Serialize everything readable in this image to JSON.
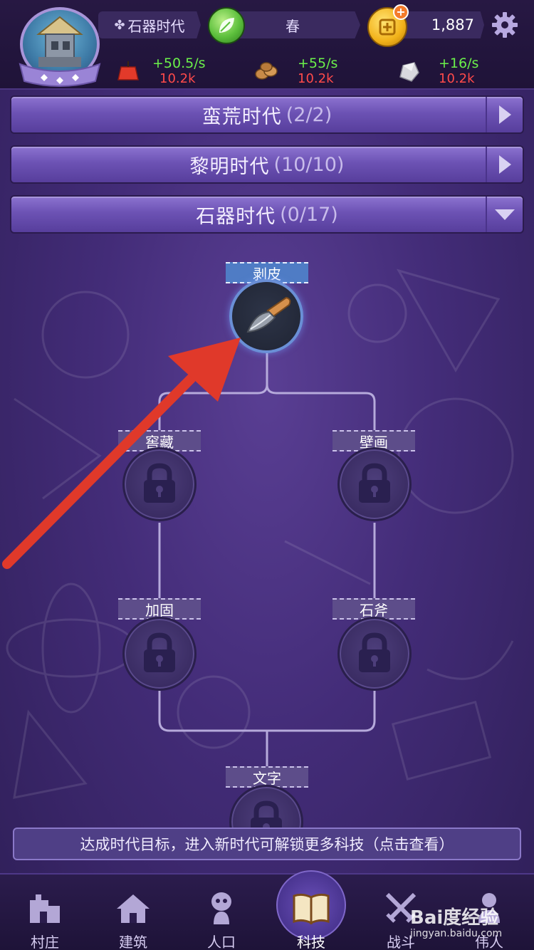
{
  "header": {
    "era_pill": "石器时代",
    "season_pill": "春",
    "gold_amount": "1,887",
    "resources": [
      {
        "icon": "apple-icon",
        "rate": "+50.5/s",
        "amount": "10.2k"
      },
      {
        "icon": "wood-logs-icon",
        "rate": "+55/s",
        "amount": "10.2k"
      },
      {
        "icon": "stone-icon",
        "rate": "+16/s",
        "amount": "10.2k"
      }
    ]
  },
  "eras": [
    {
      "name": "蛮荒时代",
      "count": "(2/2)",
      "state": "collapsed"
    },
    {
      "name": "黎明时代",
      "count": "(10/10)",
      "state": "collapsed"
    },
    {
      "name": "石器时代",
      "count": "(0/17)",
      "state": "expanded"
    }
  ],
  "tech_tree": {
    "nodes": [
      {
        "id": "skinning",
        "label": "剥皮",
        "state": "available",
        "icon": "knife-icon"
      },
      {
        "id": "cellar",
        "label": "窖藏",
        "state": "locked",
        "icon": "lock-icon"
      },
      {
        "id": "mural",
        "label": "壁画",
        "state": "locked",
        "icon": "lock-icon"
      },
      {
        "id": "reinforce",
        "label": "加固",
        "state": "locked",
        "icon": "lock-icon"
      },
      {
        "id": "stone_axe",
        "label": "石斧",
        "state": "locked",
        "icon": "lock-icon"
      },
      {
        "id": "writing",
        "label": "文字",
        "state": "locked",
        "icon": "lock-icon"
      }
    ]
  },
  "hint_text": "达成时代目标，进入新时代可解锁更多科技（点击查看）",
  "bottom_nav": [
    {
      "label": "村庄",
      "icon": "village-icon",
      "active": false
    },
    {
      "label": "建筑",
      "icon": "house-icon",
      "active": false
    },
    {
      "label": "人口",
      "icon": "person-icon",
      "active": false
    },
    {
      "label": "科技",
      "icon": "book-icon",
      "active": true
    },
    {
      "label": "战斗",
      "icon": "crossed-swords-icon",
      "active": false
    },
    {
      "label": "伟人",
      "icon": "bust-icon",
      "active": false
    }
  ],
  "watermark": {
    "main": "Bai度经验",
    "sub": "jingyan.baidu.com"
  },
  "colors": {
    "background": "#432c78",
    "era_bar": "#6c52b4",
    "active_node_border": "#6a8fd6",
    "rate_green": "#6bf04a",
    "amount_red": "#ff4a4a",
    "arrow_red": "#e0392a"
  }
}
